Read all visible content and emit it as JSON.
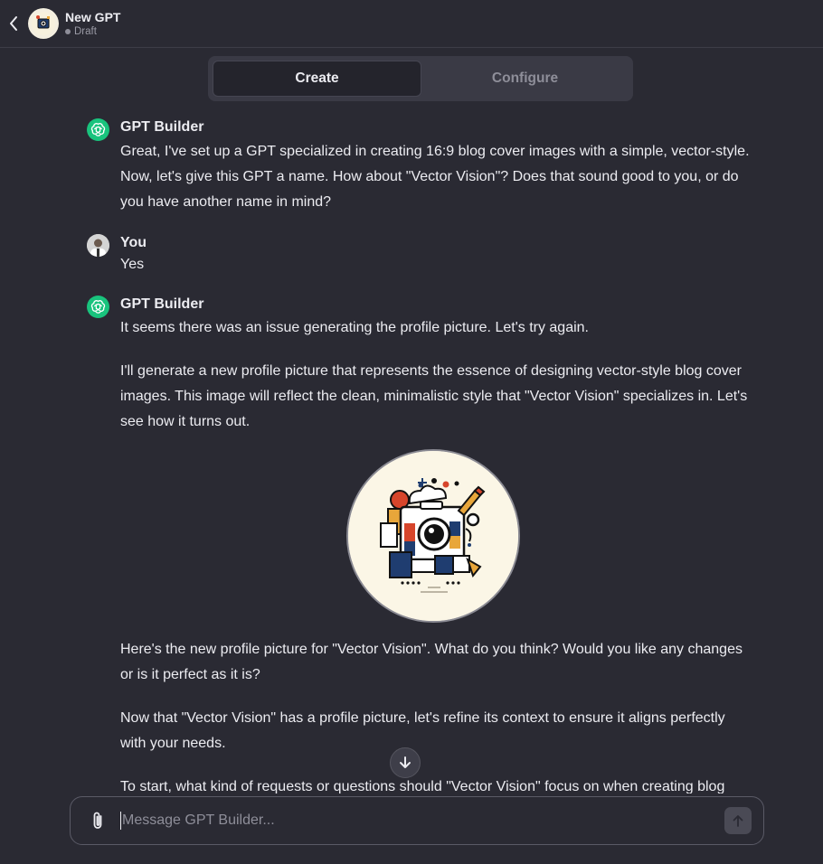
{
  "header": {
    "title": "New GPT",
    "status": "Draft"
  },
  "tabs": [
    {
      "label": "Create",
      "active": true
    },
    {
      "label": "Configure",
      "active": false
    }
  ],
  "messages": [
    {
      "author": "GPT Builder",
      "paragraphs": [
        "Great, I've set up a GPT specialized in creating 16:9 blog cover images with a simple, vector-style. Now, let's give this GPT a name. How about \"Vector Vision\"? Does that sound good to you, or do you have another name in mind?"
      ]
    },
    {
      "author": "You",
      "paragraphs": [
        "Yes"
      ]
    },
    {
      "author": "GPT Builder",
      "paragraphs": [
        "It seems there was an issue generating the profile picture. Let's try again.",
        "I'll generate a new profile picture that represents the essence of designing vector-style blog cover images. This image will reflect the clean, minimalistic style that \"Vector Vision\" specializes in. Let's see how it turns out.",
        "Here's the new profile picture for \"Vector Vision\". What do you think? Would you like any changes or is it perfect as it is?",
        "Now that \"Vector Vision\" has a profile picture, let's refine its context to ensure it aligns perfectly with your needs.",
        "To start, what kind of requests or questions should \"Vector Vision\" focus on when creating blog"
      ]
    }
  ],
  "composer": {
    "placeholder": "Message GPT Builder..."
  },
  "colors": {
    "background": "#2a2a33",
    "openai_green": "#19c37d",
    "text": "#ececf1"
  },
  "icons": [
    "chevron-left-icon",
    "openai-logo-icon",
    "paperclip-icon",
    "arrow-up-icon",
    "arrow-down-icon"
  ]
}
